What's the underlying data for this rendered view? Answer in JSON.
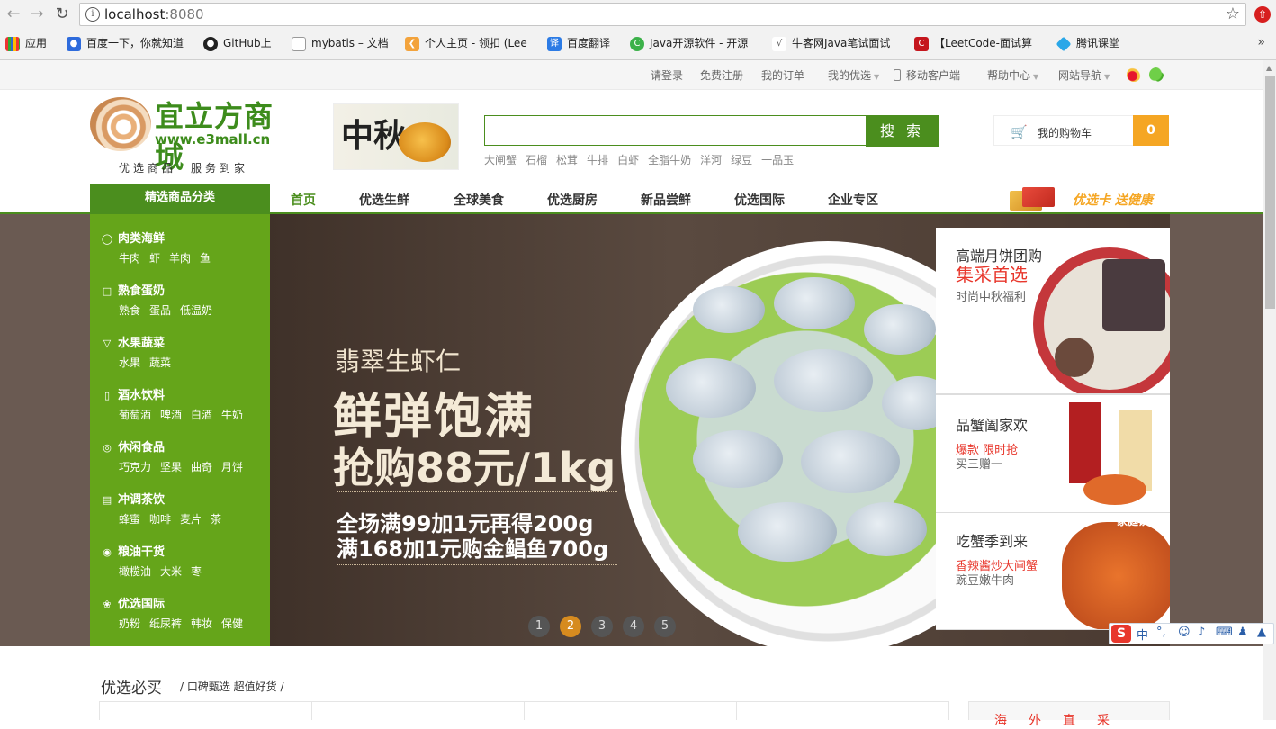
{
  "browser": {
    "url_host": "localhost",
    "url_port": ":8080",
    "bookmarks": [
      "应用",
      "百度一下，你就知道",
      "GitHub上",
      "mybatis – 文档",
      "个人主页 - 领扣 (Lee",
      "百度翻译",
      "Java开源软件 - 开源",
      "牛客网Java笔试面试",
      "【LeetCode-面试算",
      "腾讯课堂"
    ],
    "more_bookmarks": "»"
  },
  "topbar": {
    "login": "请登录",
    "register": "免费注册",
    "orders": "我的订单",
    "my_store": "我的优选",
    "mobile": "移动客户端",
    "help": "帮助中心",
    "sitenav": "网站导航"
  },
  "logo": {
    "cn": "宜立方商城",
    "en": "www.e3mall.cn",
    "slogan": "优选商品　服务到家"
  },
  "mid_ad": {
    "calligraphy": "中秋"
  },
  "search": {
    "button": "搜 索",
    "value": "",
    "hot": [
      "大闸蟹",
      "石榴",
      "松茸",
      "牛排",
      "白虾",
      "全脂牛奶",
      "洋河",
      "绿豆",
      "一品玉"
    ]
  },
  "cart": {
    "label": "我的购物车",
    "count": "0"
  },
  "nav": {
    "category_header": "精选商品分类",
    "items": [
      "首页",
      "优选生鲜",
      "全球美食",
      "优选厨房",
      "新品尝鲜",
      "优选国际",
      "企业专区"
    ],
    "promo": "优选卡 送健康"
  },
  "categories": [
    {
      "title": "肉类海鲜",
      "icon": "meat-icon",
      "subs": [
        "牛肉",
        "虾",
        "羊肉",
        "鱼"
      ]
    },
    {
      "title": "熟食蛋奶",
      "icon": "bag-icon",
      "subs": [
        "熟食",
        "蛋品",
        "低温奶"
      ]
    },
    {
      "title": "水果蔬菜",
      "icon": "fruit-icon",
      "subs": [
        "水果",
        "蔬菜"
      ]
    },
    {
      "title": "酒水饮料",
      "icon": "bottle-icon",
      "subs": [
        "葡萄酒",
        "啤酒",
        "白酒",
        "牛奶"
      ]
    },
    {
      "title": "休闲食品",
      "icon": "snack-icon",
      "subs": [
        "巧克力",
        "坚果",
        "曲奇",
        "月饼"
      ]
    },
    {
      "title": "冲调茶饮",
      "icon": "cup-icon",
      "subs": [
        "蜂蜜",
        "咖啡",
        "麦片",
        "茶"
      ]
    },
    {
      "title": "粮油干货",
      "icon": "grain-icon",
      "subs": [
        "橄榄油",
        "大米",
        "枣"
      ]
    },
    {
      "title": "优选国际",
      "icon": "leaf-icon",
      "subs": [
        "奶粉",
        "纸尿裤",
        "韩妆",
        "保健"
      ]
    }
  ],
  "banner": {
    "line1": "翡翠生虾仁",
    "line2": "鲜弹饱满",
    "line3": "抢购88元/1kg",
    "line4": "全场满99加1元再得200g",
    "line5": "满168加1元购金鲳鱼700g",
    "dots": [
      "1",
      "2",
      "3",
      "4",
      "5"
    ],
    "active_dot": 2
  },
  "side_ads": [
    {
      "t1": "高端月饼团购",
      "t2": "集采首选",
      "t3": "时尚中秋福利"
    },
    {
      "t1": "品蟹阖家欢",
      "t2": "爆款 限时抢",
      "t3": "买三赠一"
    },
    {
      "t1": "吃蟹季到来",
      "t2": "香辣酱炒大闸蟹",
      "t3": "豌豆嫩牛肉",
      "tag": "家庭饮食"
    }
  ],
  "ime": {
    "lang": "中",
    "punct": "°,"
  },
  "section": {
    "title": "优选必买",
    "subtitle": "/ 口碑甄选  超值好货 /",
    "right_title": "海外直采"
  },
  "colors": {
    "brand_green": "#4b8e1e",
    "sidebar_green": "#65a51a",
    "orange": "#f5a623",
    "red": "#e8372c"
  }
}
